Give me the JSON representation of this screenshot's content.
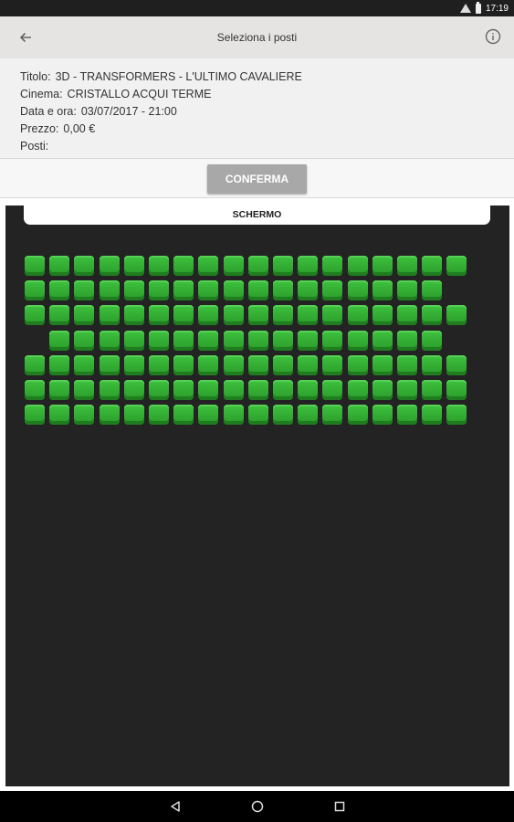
{
  "status_bar": {
    "time": "17:19",
    "icons": [
      "wifi-icon",
      "battery-icon"
    ]
  },
  "app_bar": {
    "title": "Seleziona i posti",
    "back_icon": "arrow-left-icon",
    "info_icon": "info-icon"
  },
  "details": {
    "title_label": "Titolo:",
    "title_value": "3D - TRANSFORMERS - L'ULTIMO CAVALIERE",
    "cinema_label": "Cinema:",
    "cinema_value": "CRISTALLO ACQUI TERME",
    "date_label": "Data e ora:",
    "date_value": "03/07/2017 - 21:00",
    "price_label": "Prezzo:",
    "price_value": "0,00 €",
    "seats_label": "Posti:",
    "seats_value": ""
  },
  "confirm_button": {
    "label": "CONFERMA"
  },
  "seat_map": {
    "screen_label": "SCHERMO",
    "seat_color": "#2fa82f",
    "rows": [
      {
        "seats": [
          1,
          1,
          1,
          1,
          1,
          1,
          1,
          1,
          1,
          1,
          1,
          1,
          1,
          1,
          1,
          1,
          1,
          1
        ]
      },
      {
        "seats": [
          1,
          1,
          1,
          1,
          1,
          1,
          1,
          1,
          1,
          1,
          1,
          1,
          1,
          1,
          1,
          1,
          1,
          0
        ]
      },
      {
        "seats": [
          1,
          1,
          1,
          1,
          1,
          1,
          1,
          1,
          1,
          1,
          1,
          1,
          1,
          1,
          1,
          1,
          1,
          1
        ]
      },
      {
        "seats": [
          0,
          1,
          1,
          1,
          1,
          1,
          1,
          1,
          1,
          1,
          1,
          1,
          1,
          1,
          1,
          1,
          1,
          0
        ]
      },
      {
        "seats": [
          1,
          1,
          1,
          1,
          1,
          1,
          1,
          1,
          1,
          1,
          1,
          1,
          1,
          1,
          1,
          1,
          1,
          1
        ]
      },
      {
        "seats": [
          1,
          1,
          1,
          1,
          1,
          1,
          1,
          1,
          1,
          1,
          1,
          1,
          1,
          1,
          1,
          1,
          1,
          1
        ]
      },
      {
        "seats": [
          1,
          1,
          1,
          1,
          1,
          1,
          1,
          1,
          1,
          1,
          1,
          1,
          1,
          1,
          1,
          1,
          1,
          1
        ]
      }
    ]
  },
  "nav_bar": {
    "icons": [
      "back-triangle-icon",
      "home-circle-icon",
      "recents-square-icon"
    ]
  }
}
